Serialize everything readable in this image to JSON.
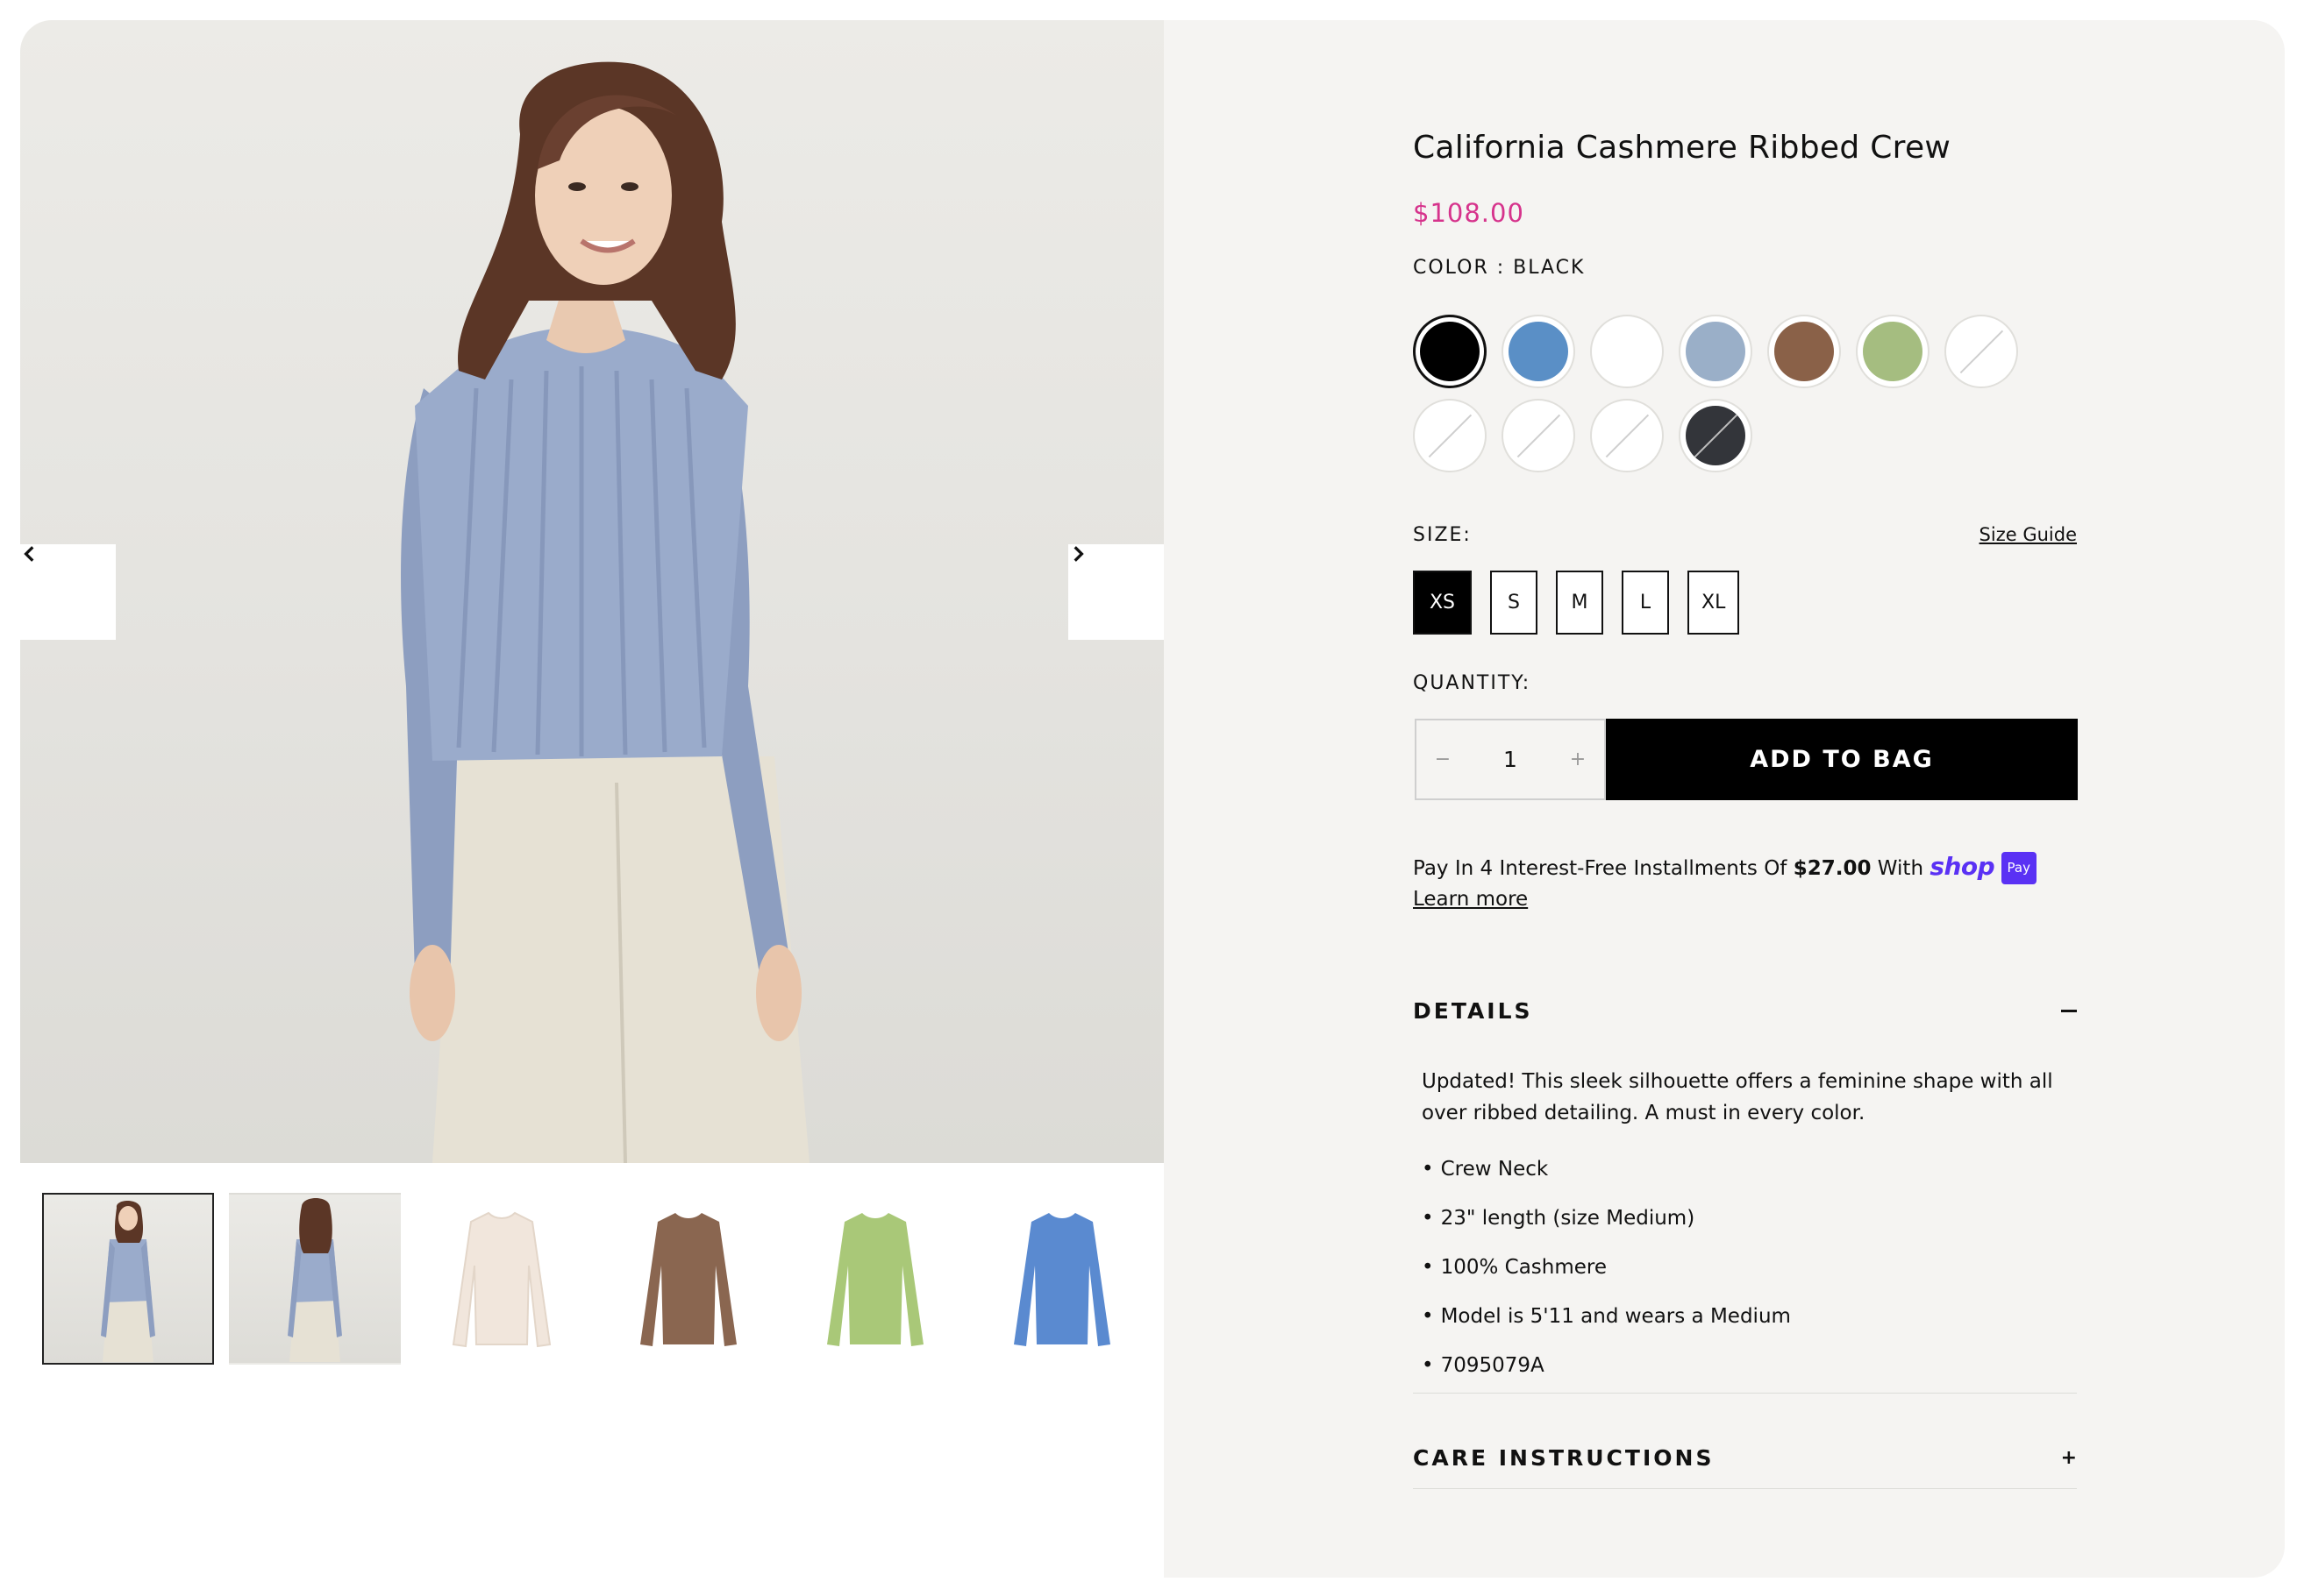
{
  "product": {
    "title": "California Cashmere Ribbed Crew",
    "price": "$108.00",
    "color_label": "COLOR : BLACK"
  },
  "swatches": [
    {
      "name": "black",
      "color": "#000000",
      "available": true,
      "selected": true
    },
    {
      "name": "blue",
      "color": "#5a8fc6",
      "available": true
    },
    {
      "name": "white",
      "color": "#ffffff",
      "available": true
    },
    {
      "name": "light-blue",
      "color": "#9aafc8",
      "available": true
    },
    {
      "name": "brown",
      "color": "#8a6148",
      "available": true
    },
    {
      "name": "sage",
      "color": "#a5bd80",
      "available": true
    },
    {
      "name": "white-unavailable-1",
      "color": "#ffffff",
      "available": false
    },
    {
      "name": "white-unavailable-2",
      "color": "#ffffff",
      "available": false
    },
    {
      "name": "white-unavailable-3",
      "color": "#ffffff",
      "available": false
    },
    {
      "name": "white-unavailable-4",
      "color": "#ffffff",
      "available": false
    },
    {
      "name": "charcoal-unavailable",
      "color": "#33353a",
      "available": false
    }
  ],
  "size": {
    "label": "SIZE:",
    "guide_label": "Size Guide",
    "options": [
      "XS",
      "S",
      "M",
      "L",
      "XL"
    ],
    "selected": "XS"
  },
  "quantity": {
    "label": "QUANTITY:",
    "value": "1",
    "decrement_icon": "−",
    "increment_icon": "+"
  },
  "add_to_bag_label": "ADD TO BAG",
  "installments": {
    "prefix": "Pay In 4 Interest-Free Installments Of ",
    "amount": "$27.00",
    "suffix": " With ",
    "shop_text": "shop",
    "pay_badge": "Pay",
    "learn_more": "Learn more"
  },
  "details": {
    "title": "DETAILS",
    "description": "Updated! This sleek silhouette offers a feminine shape with all over ribbed detailing. A must in every color.",
    "bullets": [
      "Crew Neck",
      "23\" length (size Medium)",
      "100% Cashmere",
      "Model is 5'11 and wears a Medium",
      "7095079A"
    ]
  },
  "care": {
    "title": "CARE INSTRUCTIONS",
    "toggle": "+"
  },
  "thumbnails": [
    {
      "name": "model-front",
      "active": true
    },
    {
      "name": "model-back"
    },
    {
      "name": "cream-sweater",
      "color": "#f1e6dc"
    },
    {
      "name": "brown-sweater",
      "color": "#8a6650"
    },
    {
      "name": "green-sweater",
      "color": "#a9c878"
    },
    {
      "name": "blue-sweater",
      "color": "#5a8ad0"
    }
  ]
}
